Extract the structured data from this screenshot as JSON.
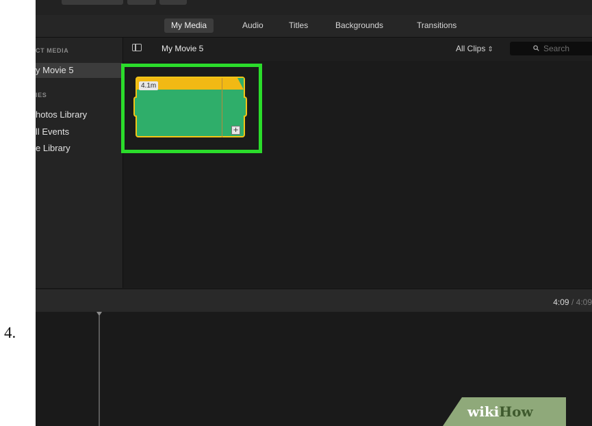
{
  "step": {
    "number": "4."
  },
  "tabs": [
    {
      "label": "My Media",
      "active": true
    },
    {
      "label": "Audio",
      "active": false
    },
    {
      "label": "Titles",
      "active": false
    },
    {
      "label": "Backgrounds",
      "active": false
    },
    {
      "label": "Transitions",
      "active": false
    }
  ],
  "sidebar": {
    "project_media_header": "CT MEDIA",
    "project_item": "y Movie 5",
    "libraries_header": "IES",
    "items": [
      "hotos Library",
      "ll Events",
      "e Library"
    ]
  },
  "browser": {
    "title": "My Movie 5",
    "filter_label": "All Clips",
    "filter_icon": "updown-arrows-icon",
    "search_placeholder": "Search",
    "clip": {
      "duration": "4.1m"
    }
  },
  "timeline": {
    "current_time": "4:09",
    "separator": "/",
    "total_time": "4:09"
  },
  "watermark": {
    "part1": "wiki",
    "part2": "How"
  },
  "colors": {
    "highlight": "#2bdc2b",
    "clip_body": "#2fae6a",
    "clip_border": "#f3c516",
    "watermark_bg": "#8fa97a"
  }
}
